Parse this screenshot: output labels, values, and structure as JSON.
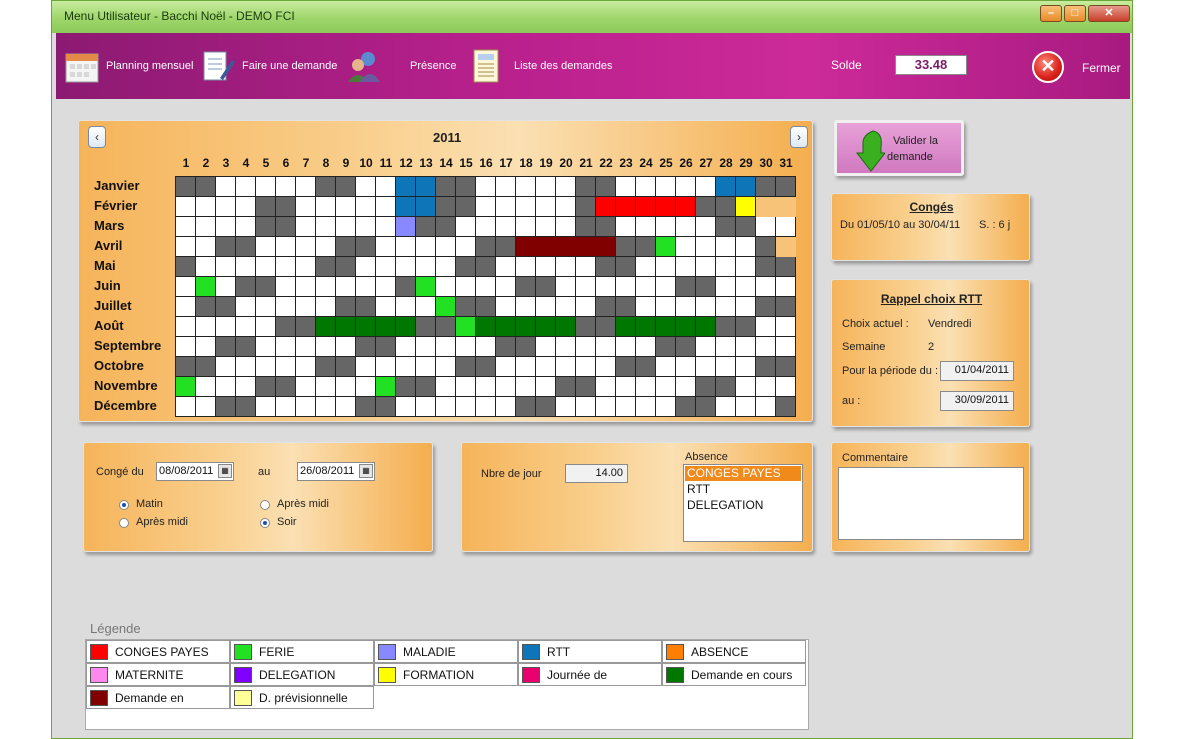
{
  "window": {
    "title": "Menu Utilisateur - Bacchi Noël - DEMO FCI"
  },
  "toolbar": {
    "planning_label": "Planning mensuel",
    "demande_label": "Faire une demande",
    "presence_label": "Présence",
    "liste_label": "Liste des demandes",
    "solde_label": "Solde",
    "solde_value": "33.48",
    "fermer_label": "Fermer"
  },
  "calendar": {
    "year": "2011",
    "prev_label": "‹",
    "next_label": "›",
    "months": [
      "Janvier",
      "Février",
      "Mars",
      "Avril",
      "Mai",
      "Juin",
      "Juillet",
      "Août",
      "Septembre",
      "Octobre",
      "Novembre",
      "Décembre"
    ],
    "days": [
      "1",
      "2",
      "3",
      "4",
      "5",
      "6",
      "7",
      "8",
      "9",
      "10",
      "11",
      "12",
      "13",
      "14",
      "15",
      "16",
      "17",
      "18",
      "19",
      "20",
      "21",
      "22",
      "23",
      "24",
      "25",
      "26",
      "27",
      "28",
      "29",
      "30",
      "31"
    ],
    "colors": {
      "weekend": "#666666",
      "empty": "#ffffff",
      "rtt": "#0e75b8",
      "ferie": "#22e022",
      "maladie": "#8888ff",
      "conges": "#ff0000",
      "formation": "#ffff00",
      "enattente": "#800000",
      "encours": "#007700",
      "closed": "#f7c378"
    },
    "rows": [
      "WWOOOOOWWOORRWWOOOOOWWOOOOORRWWO",
      "OOOOWWOOOOORRWWOOOOOWCCCCCWWYXXX",
      "OOOOWWOOOOOMWWOOOOOOWWOOOOOWWOOO",
      "OOWWOOOOWWOOOOOWWAAAAAWWFOOOOWXX",
      "WOOOOOOWWOOOOOWWOOOOOWWOOOOOOWWX",
      "OFOWWOOOOOOWFOOOOWWOOOOOOWWOOOOX",
      "OWWOOOOOWWOOOFWWOOOOOWWOOOOOOWWX",
      "OOOOOWWEEEEEWWFEEEEEWWEEEEEWWOOX",
      "OOWWOOOOOWWOOOOOWWOOOOOOWWOOOOOX",
      "WWOOOOOWWOOOOOWWOOOOOOWWOOOOOWWX",
      "FOOOWWOOOOFWWOOOOOOWWOOOOOWWOOOX",
      "OOWWOOOOOWWOOOOOOWWOOOOOOWWOOOWX"
    ]
  },
  "valider": {
    "label_line1": "Valider la",
    "label_line2": "demande"
  },
  "conges": {
    "title": "Congés",
    "periode": "Du 01/05/10 au 30/04/11",
    "solde": "S. : 6 j"
  },
  "rtt": {
    "title": "Rappel choix RTT",
    "choix_label": "Choix actuel :",
    "choix_value": "Vendredi",
    "semaine_label": "Semaine",
    "semaine_value": "2",
    "periode_label": "Pour la période du :",
    "periode_du": "01/04/2011",
    "au_label": "au :",
    "periode_au": "30/09/2011"
  },
  "demande": {
    "conge_du_label": "Congé du",
    "date_du": "08/08/2011",
    "au_label": "au",
    "date_au": "26/08/2011",
    "matin_label": "Matin",
    "apresmidi_label": "Après midi",
    "apresmidi2_label": "Après midi",
    "soir_label": "Soir"
  },
  "absence": {
    "nbjour_label": "Nbre de jour",
    "nbjour_value": "14.00",
    "absence_label": "Absence",
    "options": [
      "CONGES PAYES",
      "RTT",
      "DELEGATION"
    ],
    "selected": "CONGES PAYES"
  },
  "commentaire": {
    "label": "Commentaire"
  },
  "legend": {
    "title": "Légende",
    "items": [
      {
        "label": "CONGES PAYES",
        "color": "#ff0000"
      },
      {
        "label": "FERIE",
        "color": "#22e022"
      },
      {
        "label": "MALADIE",
        "color": "#8888ff"
      },
      {
        "label": "RTT",
        "color": "#0e75b8"
      },
      {
        "label": "ABSENCE",
        "color": "#ff7f00"
      },
      {
        "label": "MATERNITE",
        "color": "#ff88ee"
      },
      {
        "label": "DELEGATION",
        "color": "#8000ff"
      },
      {
        "label": "FORMATION",
        "color": "#ffff00"
      },
      {
        "label": "Journée de",
        "color": "#e8006e"
      },
      {
        "label": "Demande en cours",
        "color": "#007700"
      },
      {
        "label": "Demande  en",
        "color": "#800000"
      },
      {
        "label": "D. prévisionnelle",
        "color": "#ffff99"
      }
    ]
  }
}
